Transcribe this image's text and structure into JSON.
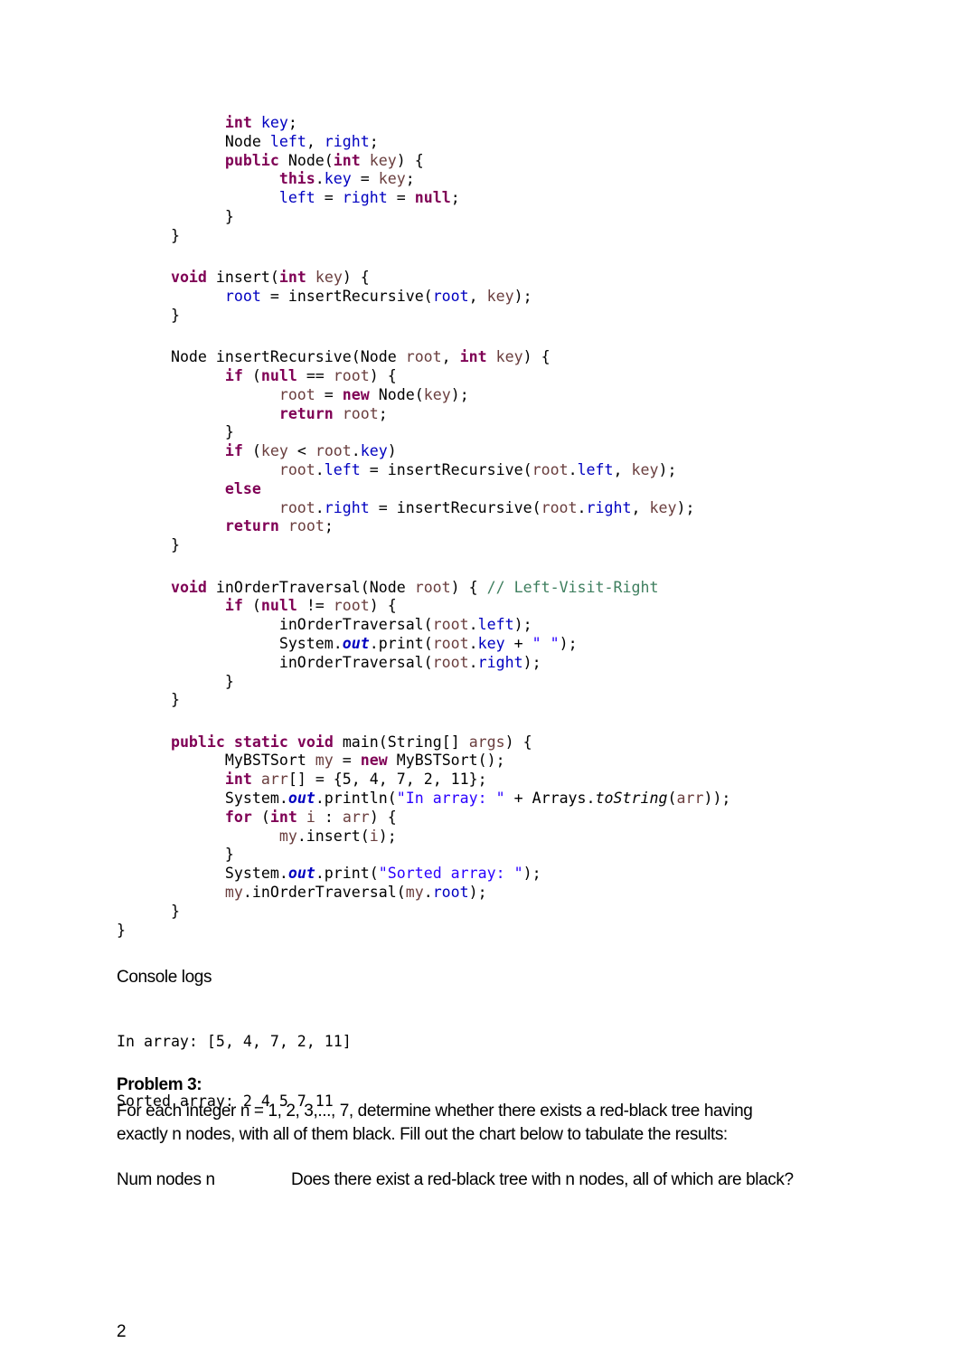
{
  "code": {
    "language": "java",
    "lines": [
      {
        "indent": 2,
        "tokens": [
          {
            "t": "int",
            "c": "kw"
          },
          {
            "t": " "
          },
          {
            "t": "key",
            "c": "fld"
          },
          {
            "t": ";"
          }
        ]
      },
      {
        "indent": 2,
        "tokens": [
          {
            "t": "Node "
          },
          {
            "t": "left",
            "c": "fld"
          },
          {
            "t": ", "
          },
          {
            "t": "right",
            "c": "fld"
          },
          {
            "t": ";"
          }
        ]
      },
      {
        "indent": 2,
        "tokens": [
          {
            "t": "public",
            "c": "kw"
          },
          {
            "t": " Node("
          },
          {
            "t": "int",
            "c": "kw"
          },
          {
            "t": " "
          },
          {
            "t": "key",
            "c": "loc"
          },
          {
            "t": ") {"
          }
        ]
      },
      {
        "indent": 3,
        "tokens": [
          {
            "t": "this",
            "c": "kw"
          },
          {
            "t": "."
          },
          {
            "t": "key",
            "c": "fld"
          },
          {
            "t": " = "
          },
          {
            "t": "key",
            "c": "loc"
          },
          {
            "t": ";"
          }
        ]
      },
      {
        "indent": 3,
        "tokens": [
          {
            "t": "left",
            "c": "fld"
          },
          {
            "t": " = "
          },
          {
            "t": "right",
            "c": "fld"
          },
          {
            "t": " = "
          },
          {
            "t": "null",
            "c": "kw"
          },
          {
            "t": ";"
          }
        ]
      },
      {
        "indent": 2,
        "tokens": [
          {
            "t": "}"
          }
        ]
      },
      {
        "indent": 1,
        "tokens": [
          {
            "t": "}"
          }
        ]
      },
      {
        "blank": true
      },
      {
        "indent": 1,
        "tokens": [
          {
            "t": "void",
            "c": "kw"
          },
          {
            "t": " insert("
          },
          {
            "t": "int",
            "c": "kw"
          },
          {
            "t": " "
          },
          {
            "t": "key",
            "c": "loc"
          },
          {
            "t": ") {"
          }
        ]
      },
      {
        "indent": 2,
        "tokens": [
          {
            "t": "root",
            "c": "fld"
          },
          {
            "t": " = insertRecursive("
          },
          {
            "t": "root",
            "c": "fld"
          },
          {
            "t": ", "
          },
          {
            "t": "key",
            "c": "loc"
          },
          {
            "t": ");"
          }
        ]
      },
      {
        "indent": 1,
        "tokens": [
          {
            "t": "}"
          }
        ]
      },
      {
        "blank": true
      },
      {
        "indent": 1,
        "tokens": [
          {
            "t": "Node insertRecursive(Node "
          },
          {
            "t": "root",
            "c": "loc"
          },
          {
            "t": ", "
          },
          {
            "t": "int",
            "c": "kw"
          },
          {
            "t": " "
          },
          {
            "t": "key",
            "c": "loc"
          },
          {
            "t": ") {"
          }
        ]
      },
      {
        "indent": 2,
        "tokens": [
          {
            "t": "if",
            "c": "kw"
          },
          {
            "t": " ("
          },
          {
            "t": "null",
            "c": "kw"
          },
          {
            "t": " == "
          },
          {
            "t": "root",
            "c": "loc"
          },
          {
            "t": ") {"
          }
        ]
      },
      {
        "indent": 3,
        "tokens": [
          {
            "t": "root",
            "c": "loc"
          },
          {
            "t": " = "
          },
          {
            "t": "new",
            "c": "kw"
          },
          {
            "t": " Node("
          },
          {
            "t": "key",
            "c": "loc"
          },
          {
            "t": ");"
          }
        ]
      },
      {
        "indent": 3,
        "tokens": [
          {
            "t": "return",
            "c": "kw"
          },
          {
            "t": " "
          },
          {
            "t": "root",
            "c": "loc"
          },
          {
            "t": ";"
          }
        ]
      },
      {
        "indent": 2,
        "tokens": [
          {
            "t": "}"
          }
        ]
      },
      {
        "indent": 2,
        "tokens": [
          {
            "t": "if",
            "c": "kw"
          },
          {
            "t": " ("
          },
          {
            "t": "key",
            "c": "loc"
          },
          {
            "t": " < "
          },
          {
            "t": "root",
            "c": "loc"
          },
          {
            "t": "."
          },
          {
            "t": "key",
            "c": "fld"
          },
          {
            "t": ")"
          }
        ]
      },
      {
        "indent": 3,
        "tokens": [
          {
            "t": "root",
            "c": "loc"
          },
          {
            "t": "."
          },
          {
            "t": "left",
            "c": "fld"
          },
          {
            "t": " = insertRecursive("
          },
          {
            "t": "root",
            "c": "loc"
          },
          {
            "t": "."
          },
          {
            "t": "left",
            "c": "fld"
          },
          {
            "t": ", "
          },
          {
            "t": "key",
            "c": "loc"
          },
          {
            "t": ");"
          }
        ]
      },
      {
        "indent": 2,
        "tokens": [
          {
            "t": "else",
            "c": "kw"
          }
        ]
      },
      {
        "indent": 3,
        "tokens": [
          {
            "t": "root",
            "c": "loc"
          },
          {
            "t": "."
          },
          {
            "t": "right",
            "c": "fld"
          },
          {
            "t": " = insertRecursive("
          },
          {
            "t": "root",
            "c": "loc"
          },
          {
            "t": "."
          },
          {
            "t": "right",
            "c": "fld"
          },
          {
            "t": ", "
          },
          {
            "t": "key",
            "c": "loc"
          },
          {
            "t": ");"
          }
        ]
      },
      {
        "indent": 2,
        "tokens": [
          {
            "t": "return",
            "c": "kw"
          },
          {
            "t": " "
          },
          {
            "t": "root",
            "c": "loc"
          },
          {
            "t": ";"
          }
        ]
      },
      {
        "indent": 1,
        "tokens": [
          {
            "t": "}"
          }
        ]
      },
      {
        "blank": true
      },
      {
        "indent": 1,
        "tokens": [
          {
            "t": "void",
            "c": "kw"
          },
          {
            "t": " inOrderTraversal(Node "
          },
          {
            "t": "root",
            "c": "loc"
          },
          {
            "t": ") { "
          },
          {
            "t": "// Left-Visit-Right",
            "c": "cmt"
          }
        ]
      },
      {
        "indent": 2,
        "tokens": [
          {
            "t": "if",
            "c": "kw"
          },
          {
            "t": " ("
          },
          {
            "t": "null",
            "c": "kw"
          },
          {
            "t": " != "
          },
          {
            "t": "root",
            "c": "loc"
          },
          {
            "t": ") {"
          }
        ]
      },
      {
        "indent": 3,
        "tokens": [
          {
            "t": "inOrderTraversal("
          },
          {
            "t": "root",
            "c": "loc"
          },
          {
            "t": "."
          },
          {
            "t": "left",
            "c": "fld"
          },
          {
            "t": ");"
          }
        ]
      },
      {
        "indent": 3,
        "tokens": [
          {
            "t": "System."
          },
          {
            "t": "out",
            "c": "sfld"
          },
          {
            "t": ".print("
          },
          {
            "t": "root",
            "c": "loc"
          },
          {
            "t": "."
          },
          {
            "t": "key",
            "c": "fld"
          },
          {
            "t": " + "
          },
          {
            "t": "\" \"",
            "c": "str"
          },
          {
            "t": ");"
          }
        ]
      },
      {
        "indent": 3,
        "tokens": [
          {
            "t": "inOrderTraversal("
          },
          {
            "t": "root",
            "c": "loc"
          },
          {
            "t": "."
          },
          {
            "t": "right",
            "c": "fld"
          },
          {
            "t": ");"
          }
        ]
      },
      {
        "indent": 2,
        "tokens": [
          {
            "t": "}"
          }
        ]
      },
      {
        "indent": 1,
        "tokens": [
          {
            "t": "}"
          }
        ]
      },
      {
        "blank": true
      },
      {
        "indent": 1,
        "tokens": [
          {
            "t": "public",
            "c": "kw"
          },
          {
            "t": " "
          },
          {
            "t": "static",
            "c": "kw"
          },
          {
            "t": " "
          },
          {
            "t": "void",
            "c": "kw"
          },
          {
            "t": " main(String[] "
          },
          {
            "t": "args",
            "c": "loc"
          },
          {
            "t": ") {"
          }
        ]
      },
      {
        "indent": 2,
        "tokens": [
          {
            "t": "MyBSTSort "
          },
          {
            "t": "my",
            "c": "loc"
          },
          {
            "t": " = "
          },
          {
            "t": "new",
            "c": "kw"
          },
          {
            "t": " MyBSTSort();"
          }
        ]
      },
      {
        "indent": 2,
        "tokens": [
          {
            "t": "int",
            "c": "kw"
          },
          {
            "t": " "
          },
          {
            "t": "arr",
            "c": "loc"
          },
          {
            "t": "[] = {5, 4, 7, 2, 11};"
          }
        ]
      },
      {
        "indent": 2,
        "tokens": [
          {
            "t": "System."
          },
          {
            "t": "out",
            "c": "sfld"
          },
          {
            "t": ".println("
          },
          {
            "t": "\"In array: \"",
            "c": "str"
          },
          {
            "t": " + Arrays."
          },
          {
            "t": "toString",
            "c": "sm"
          },
          {
            "t": "("
          },
          {
            "t": "arr",
            "c": "loc"
          },
          {
            "t": "));"
          }
        ]
      },
      {
        "indent": 2,
        "tokens": [
          {
            "t": "for",
            "c": "kw"
          },
          {
            "t": " ("
          },
          {
            "t": "int",
            "c": "kw"
          },
          {
            "t": " "
          },
          {
            "t": "i",
            "c": "loc"
          },
          {
            "t": " : "
          },
          {
            "t": "arr",
            "c": "loc"
          },
          {
            "t": ") {"
          }
        ]
      },
      {
        "indent": 3,
        "tokens": [
          {
            "t": "my",
            "c": "loc"
          },
          {
            "t": ".insert("
          },
          {
            "t": "i",
            "c": "loc"
          },
          {
            "t": ");"
          }
        ]
      },
      {
        "indent": 2,
        "tokens": [
          {
            "t": "}"
          }
        ]
      },
      {
        "indent": 2,
        "tokens": [
          {
            "t": "System."
          },
          {
            "t": "out",
            "c": "sfld"
          },
          {
            "t": ".print("
          },
          {
            "t": "\"Sorted array: \"",
            "c": "str"
          },
          {
            "t": ");"
          }
        ]
      },
      {
        "indent": 2,
        "tokens": [
          {
            "t": "my",
            "c": "loc"
          },
          {
            "t": ".inOrderTraversal("
          },
          {
            "t": "my",
            "c": "loc"
          },
          {
            "t": "."
          },
          {
            "t": "root",
            "c": "fld"
          },
          {
            "t": ");"
          }
        ]
      },
      {
        "indent": 1,
        "tokens": [
          {
            "t": "}"
          }
        ]
      },
      {
        "indent": 0,
        "tokens": [
          {
            "t": "}"
          }
        ]
      }
    ]
  },
  "console": {
    "title": "Console logs",
    "lines": [
      "In array: [5, 4, 7, 2, 11]",
      "Sorted array: 2 4 5 7 11"
    ]
  },
  "problem3": {
    "title": "Problem 3:",
    "body": "For each integer n = 1, 2, 3,..., 7, determine whether there exists a red-black tree having exactly n nodes, with all of them black. Fill out the chart below to tabulate the results:",
    "table_header": {
      "col1": "Num nodes n",
      "col2": "Does there exist a red-black tree with n nodes, all of which are black?"
    }
  },
  "page_number": "2"
}
